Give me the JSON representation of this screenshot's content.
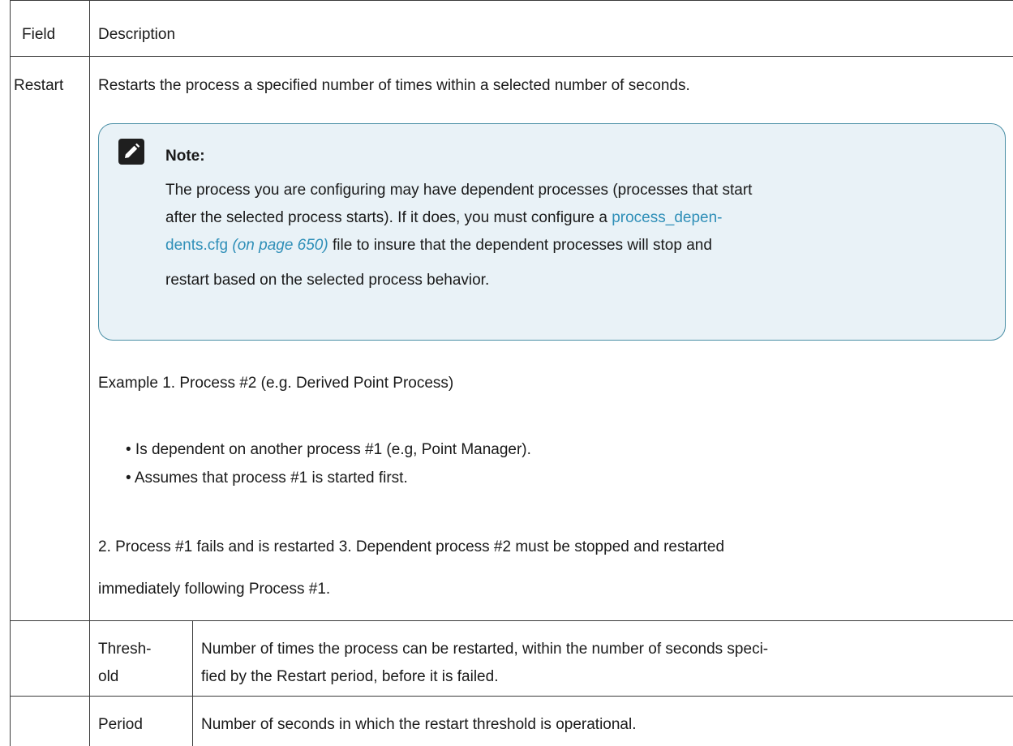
{
  "table": {
    "header": {
      "field": "Field",
      "description": "Description"
    },
    "restart_row": {
      "field": "Restart",
      "intro": "Restarts the process a specified number of times within a selected number of seconds.",
      "note": {
        "title": "Note:",
        "line1": "The process you are configuring may have dependent processes (processes that start",
        "line2": "after the selected process starts). If it does, you must configure a",
        "link_part1": "process_depen-",
        "link_part2": "dents.cfg",
        "link_page": "(on page 650)",
        "line3_rest": "file to insure that the dependent processes will stop and",
        "line4": "restart based on the selected process behavior."
      },
      "example_line": "Example 1.   Process #2 (e.g. Derived Point Process)",
      "bullets": [
        "• Is dependent on another process #1 (e.g, Point Manager).",
        "• Assumes that process #1 is started first."
      ],
      "step_line1": "2.   Process #1 fails and is restarted 3.   Dependent process #2 must be stopped and restarted",
      "step_line2": "immediately following Process #1."
    },
    "threshold_row": {
      "label_line1": "Thresh-",
      "label_line2": "old",
      "desc_line1": "Number of times the process can be restarted, within the number of seconds speci-",
      "desc_line2": "fied by the Restart period, before it is failed."
    },
    "period_row": {
      "label": "Period",
      "desc": "Number of seconds in which the restart threshold is operational."
    }
  },
  "colors": {
    "link": "#2f8fb8",
    "note_border": "#4a8fa6",
    "note_bg": "#e9f2f7"
  }
}
